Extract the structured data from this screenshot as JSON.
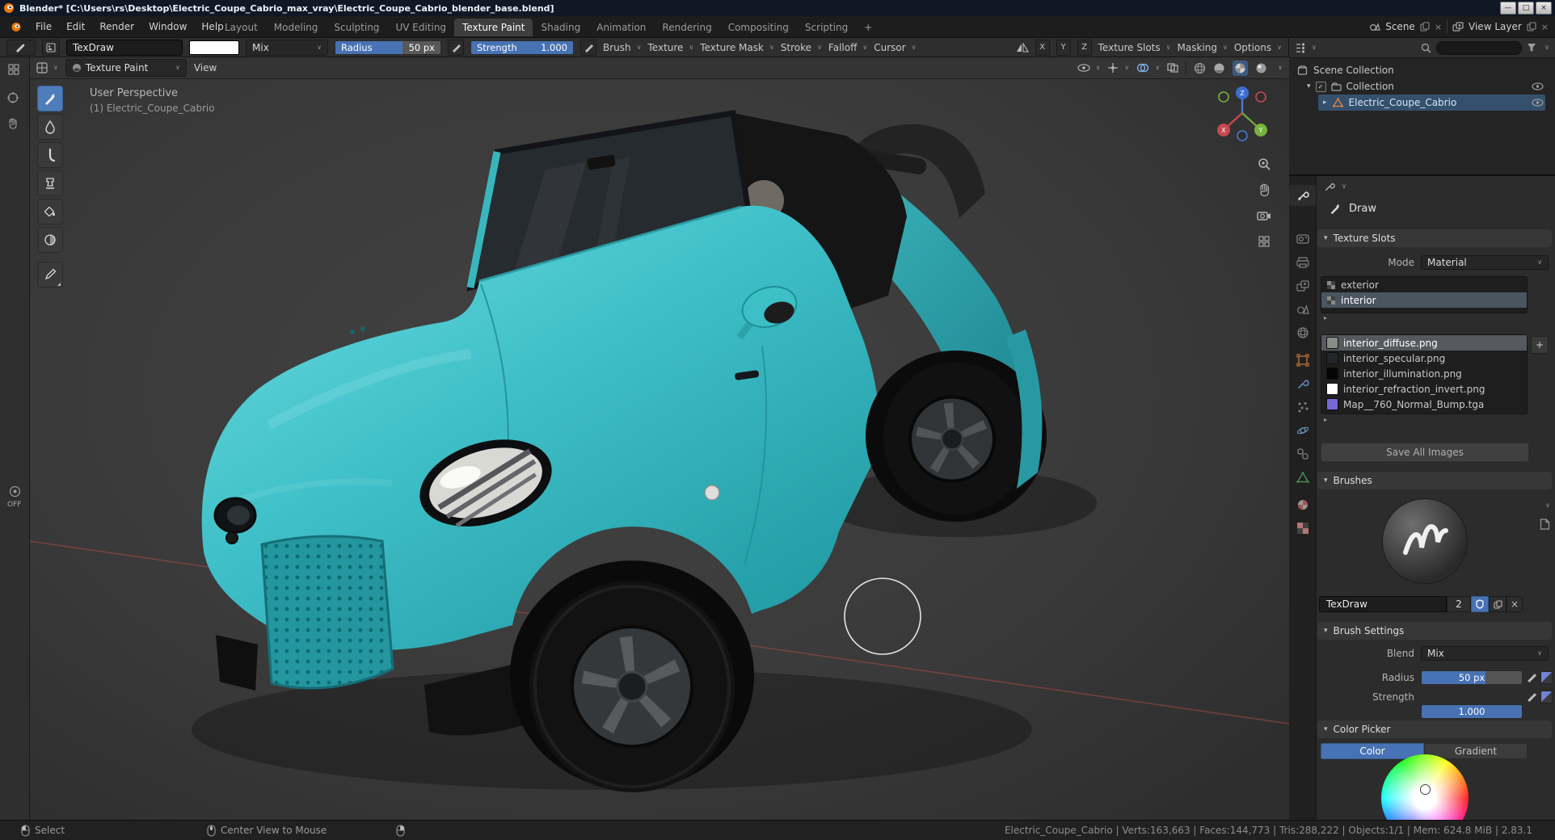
{
  "colors": {
    "accent": "#4772B3",
    "car_body": "#3FC3C9",
    "selected_row": "#35506D"
  },
  "icons": {
    "chevron": "∨",
    "panel_open": "▾",
    "panel_closed": "▸",
    "check": "✓",
    "close": "×",
    "add": "+",
    "minimize": "—",
    "maximize": "□"
  },
  "titlebar": {
    "title": "Blender* [C:\\Users\\rs\\Desktop\\Electric_Coupe_Cabrio_max_vray\\Electric_Coupe_Cabrio_blender_base.blend]"
  },
  "menubar": {
    "menus": [
      "File",
      "Edit",
      "Render",
      "Window",
      "Help"
    ],
    "workspaces": [
      "Layout",
      "Modeling",
      "Sculpting",
      "UV Editing",
      "Texture Paint",
      "Shading",
      "Animation",
      "Rendering",
      "Compositing",
      "Scripting"
    ],
    "active_workspace": "Texture Paint",
    "scene_label": "Scene",
    "view_layer_label": "View Layer"
  },
  "tool_settings": {
    "brush_datablock": "TexDraw",
    "blend_mode": "Mix",
    "radius_label": "Radius",
    "radius_value": "50 px",
    "strength_label": "Strength",
    "strength_value": "1.000",
    "brush_menu": "Brush",
    "texture_menu": "Texture",
    "texture_mask_menu": "Texture Mask",
    "stroke_menu": "Stroke",
    "falloff_menu": "Falloff",
    "cursor_menu": "Cursor",
    "mirror_x": "X",
    "mirror_y": "Y",
    "mirror_z": "Z",
    "texture_slots_menu": "Texture Slots",
    "masking_menu": "Masking",
    "options_menu": "Options"
  },
  "viewport": {
    "mode": "Texture Paint",
    "view_menu": "View",
    "overlay_perspective": "User Perspective",
    "overlay_object": "(1) Electric_Coupe_Cabrio",
    "gizmo": {
      "x": "X",
      "y": "Y",
      "z": "Z"
    }
  },
  "left_strip": {
    "off": "OFF"
  },
  "outliner": {
    "scene_collection": "Scene Collection",
    "collection": "Collection",
    "object": "Electric_Coupe_Cabrio"
  },
  "properties": {
    "active_tool_label": "Draw",
    "texture_slots": {
      "panel": "Texture Slots",
      "mode_label": "Mode",
      "mode_value": "Material",
      "slots": [
        "exterior",
        "interior"
      ],
      "selected_slot": "interior",
      "images": [
        {
          "name": "interior_diffuse.png",
          "swatch": "#8C8C86"
        },
        {
          "name": "interior_specular.png",
          "swatch": "#23262B"
        },
        {
          "name": "interior_illumination.png",
          "swatch": "#050505"
        },
        {
          "name": "interior_refraction_invert.png",
          "swatch": "#FFFFFF"
        },
        {
          "name": "Map__760_Normal_Bump.tga",
          "swatch": "#7569D6"
        }
      ],
      "save_all": "Save All Images"
    },
    "brushes": {
      "panel": "Brushes",
      "brush_name": "TexDraw",
      "users_count": "2"
    },
    "brush_settings": {
      "panel": "Brush Settings",
      "blend_label": "Blend",
      "blend_value": "Mix",
      "radius_label": "Radius",
      "radius_value": "50 px",
      "strength_label": "Strength",
      "strength_value": "1.000"
    },
    "color_picker": {
      "panel": "Color Picker",
      "color_tab": "Color",
      "gradient_tab": "Gradient"
    }
  },
  "status_bar": {
    "select_label": "Select",
    "center_view_label": "Center View to Mouse",
    "stats": "Electric_Coupe_Cabrio | Verts:163,663 | Faces:144,773 | Tris:288,222 | Objects:1/1 | Mem: 624.8 MiB | 2.83.1"
  }
}
